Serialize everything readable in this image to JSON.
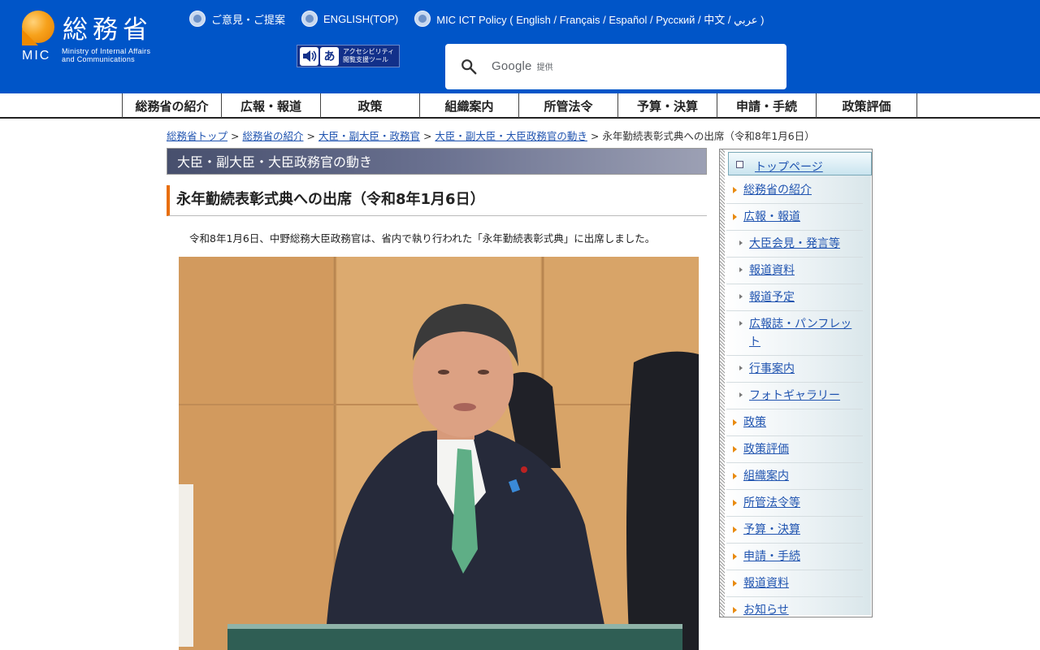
{
  "header": {
    "logo_ja": "総務省",
    "logo_mic": "MIC",
    "logo_en_line1": "Ministry of Internal Affairs",
    "logo_en_line2": "and Communications",
    "top_links": [
      {
        "label": "ご意見・ご提案"
      },
      {
        "label": "ENGLISH(TOP)"
      },
      {
        "label": "MIC ICT Policy ( English / Français / Español / Русский / 中文 / عربي )"
      }
    ],
    "accessibility_tool_label": "アクセシビリティ\n閲覧支援ツール",
    "search": {
      "provider_label": "Google",
      "provider_suffix": "提供",
      "placeholder": ""
    }
  },
  "global_nav": [
    {
      "label": "総務省の紹介"
    },
    {
      "label": "広報・報道"
    },
    {
      "label": "政策"
    },
    {
      "label": "組織案内"
    },
    {
      "label": "所管法令"
    },
    {
      "label": "予算・決算"
    },
    {
      "label": "申請・手続"
    },
    {
      "label": "政策評価"
    }
  ],
  "breadcrumb": {
    "items": [
      "総務省トップ",
      "総務省の紹介",
      "大臣・副大臣・政務官",
      "大臣・副大臣・大臣政務官の動き"
    ],
    "separator": ">",
    "current": "永年勤続表彰式典への出席（令和8年1月6日）"
  },
  "main": {
    "section_heading": "大臣・副大臣・大臣政務官の動き",
    "title": "永年勤続表彰式典への出席（令和8年1月6日）",
    "lead": "令和8年1月6日、中野総務大臣政務官は、省内で執り行われた「永年勤続表彰式典」に出席しました。"
  },
  "sidebar": {
    "top_label": "トップページ",
    "items": [
      {
        "label": "総務省の紹介",
        "level": 1
      },
      {
        "label": "広報・報道",
        "level": 1
      },
      {
        "label": "大臣会見・発言等",
        "level": 2
      },
      {
        "label": "報道資料",
        "level": 2
      },
      {
        "label": "報道予定",
        "level": 2
      },
      {
        "label": "広報誌・パンフレット",
        "level": 2
      },
      {
        "label": "行事案内",
        "level": 2
      },
      {
        "label": "フォトギャラリー",
        "level": 2
      },
      {
        "label": "政策",
        "level": 1
      },
      {
        "label": "政策評価",
        "level": 1
      },
      {
        "label": "組織案内",
        "level": 1
      },
      {
        "label": "所管法令等",
        "level": 1
      },
      {
        "label": "予算・決算",
        "level": 1
      },
      {
        "label": "申請・手続",
        "level": 1
      },
      {
        "label": "報道資料",
        "level": 1
      },
      {
        "label": "お知らせ",
        "level": 1
      }
    ]
  },
  "colors": {
    "header_blue": "#0055c8",
    "logo_orange": "#f08a00",
    "title_accent": "#e86e0c",
    "link_blue": "#2054b0"
  }
}
